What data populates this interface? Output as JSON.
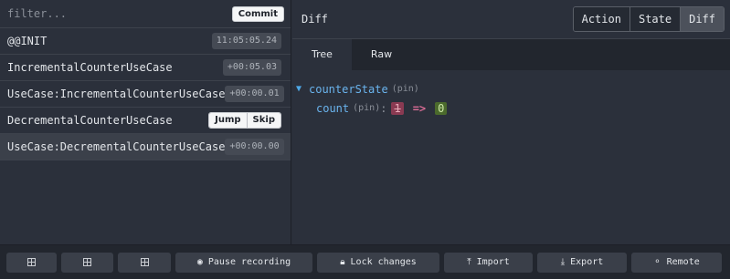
{
  "left": {
    "filter_placeholder": "filter...",
    "commit_label": "Commit",
    "actions": [
      {
        "name": "@@INIT",
        "time": "11:05:05.24"
      },
      {
        "name": "IncrementalCounterUseCase",
        "time": "+00:05.03"
      },
      {
        "name": "UseCase:IncrementalCounterUseCase",
        "time": "+00:00.01"
      },
      {
        "name": "DecrementalCounterUseCase",
        "jump_label": "Jump",
        "skip_label": "Skip"
      },
      {
        "name": "UseCase:DecrementalCounterUseCase",
        "time": "+00:00.00",
        "selected": true
      }
    ]
  },
  "right": {
    "title": "Diff",
    "tabs": [
      "Action",
      "State",
      "Diff"
    ],
    "active_tab": "Diff",
    "subtabs": [
      "Tree",
      "Raw"
    ],
    "active_subtab": "Tree",
    "tree": {
      "root_key": "counterState",
      "root_pin": "(pin)",
      "child_key": "count",
      "child_pin": "(pin)",
      "colon": ":",
      "old_value": "1",
      "arrow": "=>",
      "new_value": "0"
    }
  },
  "bottom": {
    "buttons": [
      {
        "icon": "grid-icon",
        "label": ""
      },
      {
        "icon": "grid-icon",
        "label": ""
      },
      {
        "icon": "grid-icon",
        "label": ""
      },
      {
        "icon": "record-icon",
        "label": "Pause recording"
      },
      {
        "icon": "lock-icon",
        "label": "Lock changes"
      },
      {
        "icon": "upload-icon",
        "label": "Import"
      },
      {
        "icon": "download-icon",
        "label": "Export"
      },
      {
        "icon": "antenna-icon",
        "label": "Remote"
      }
    ]
  },
  "colors": {
    "background": "#2b303b",
    "old_value_bg": "#8a3a52",
    "new_value_bg": "#4b6a2c",
    "key_color": "#6ab4ee"
  }
}
